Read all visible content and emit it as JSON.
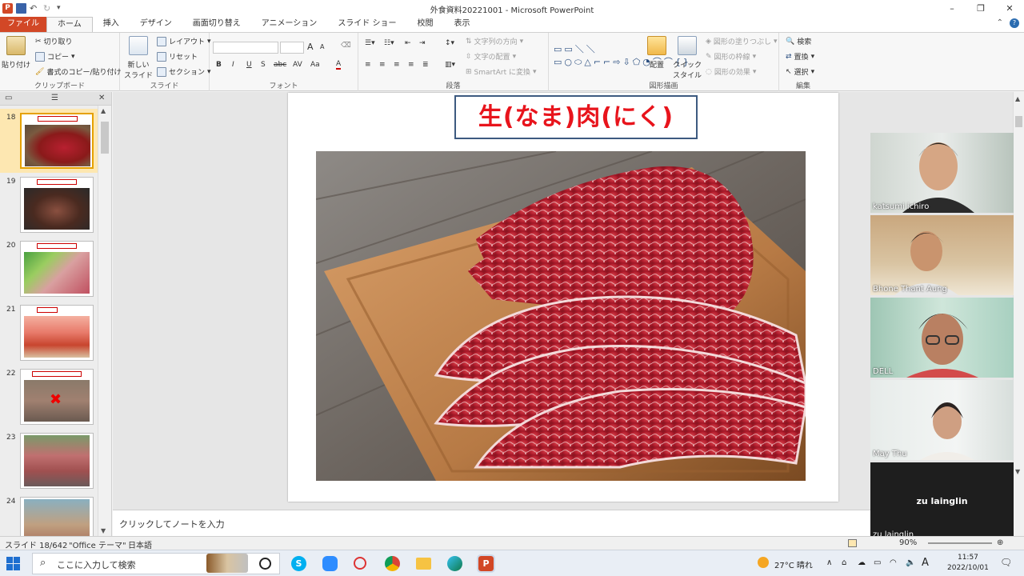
{
  "window": {
    "title": "外食資料20221001 - Microsoft PowerPoint",
    "controls": [
      "–",
      "❐",
      "✕"
    ]
  },
  "tabs": [
    {
      "label": "ファイル"
    },
    {
      "label": "ホーム"
    },
    {
      "label": "挿入"
    },
    {
      "label": "デザイン"
    },
    {
      "label": "画面切り替え"
    },
    {
      "label": "アニメーション"
    },
    {
      "label": "スライド ショー"
    },
    {
      "label": "校閲"
    },
    {
      "label": "表示"
    }
  ],
  "ribbon": {
    "clipboard": {
      "paste": "貼り付け",
      "cut": "切り取り",
      "copy": "コピー",
      "format_painter": "書式のコピー/貼り付け",
      "label": "クリップボード"
    },
    "slides": {
      "new_slide": "新しい\nスライド",
      "layout": "レイアウト",
      "reset": "リセット",
      "section": "セクション",
      "label": "スライド"
    },
    "font": {
      "label": "フォント",
      "bold": "B",
      "italic": "I",
      "underline": "U",
      "shadow": "S",
      "strike": "abc",
      "spacing": "AV",
      "case": "Aa",
      "color": "A",
      "grow": "A",
      "shrink": "A"
    },
    "paragraph": {
      "text_direction": "文字列の方向",
      "align_text": "文字の配置",
      "smartart": "SmartArt に変換",
      "label": "段落"
    },
    "drawing": {
      "arrange": "配置",
      "quick_styles": "クイック\nスタイル",
      "shape_fill": "図形の塗りつぶし",
      "shape_outline": "図形の枠線",
      "shape_effects": "図形の効果",
      "label": "図形描画"
    },
    "editing": {
      "find": "検索",
      "replace": "置換",
      "select": "選択",
      "label": "編集"
    }
  },
  "thumbnails": [
    {
      "num": "18",
      "selected": true
    },
    {
      "num": "19",
      "selected": false
    },
    {
      "num": "20",
      "selected": false
    },
    {
      "num": "21",
      "selected": false
    },
    {
      "num": "22",
      "selected": false
    },
    {
      "num": "23",
      "selected": false
    },
    {
      "num": "24",
      "selected": false
    }
  ],
  "slide": {
    "title": "生(なま)肉(にく)"
  },
  "notes": {
    "placeholder": "クリックしてノートを入力"
  },
  "participants": [
    {
      "name": "katsumi ichiro"
    },
    {
      "name": "Bhone Thant Aung"
    },
    {
      "name": "DELL"
    },
    {
      "name": "May Thu"
    },
    {
      "name": "zu lainglin",
      "center_name": "zu lainglin"
    }
  ],
  "statusbar": {
    "slide_info": "スライド 18/642",
    "theme": "\"Office テーマ\"",
    "language": "日本語",
    "zoom": "90%"
  },
  "taskbar": {
    "search_placeholder": "ここに入力して検索",
    "weather": "27°C 晴れ",
    "time": "11:57",
    "date": "2022/10/01",
    "ime": "A"
  },
  "colors": {
    "file_tab": "#d24726",
    "title_red": "#e8141c",
    "selection": "#fde7b1"
  }
}
